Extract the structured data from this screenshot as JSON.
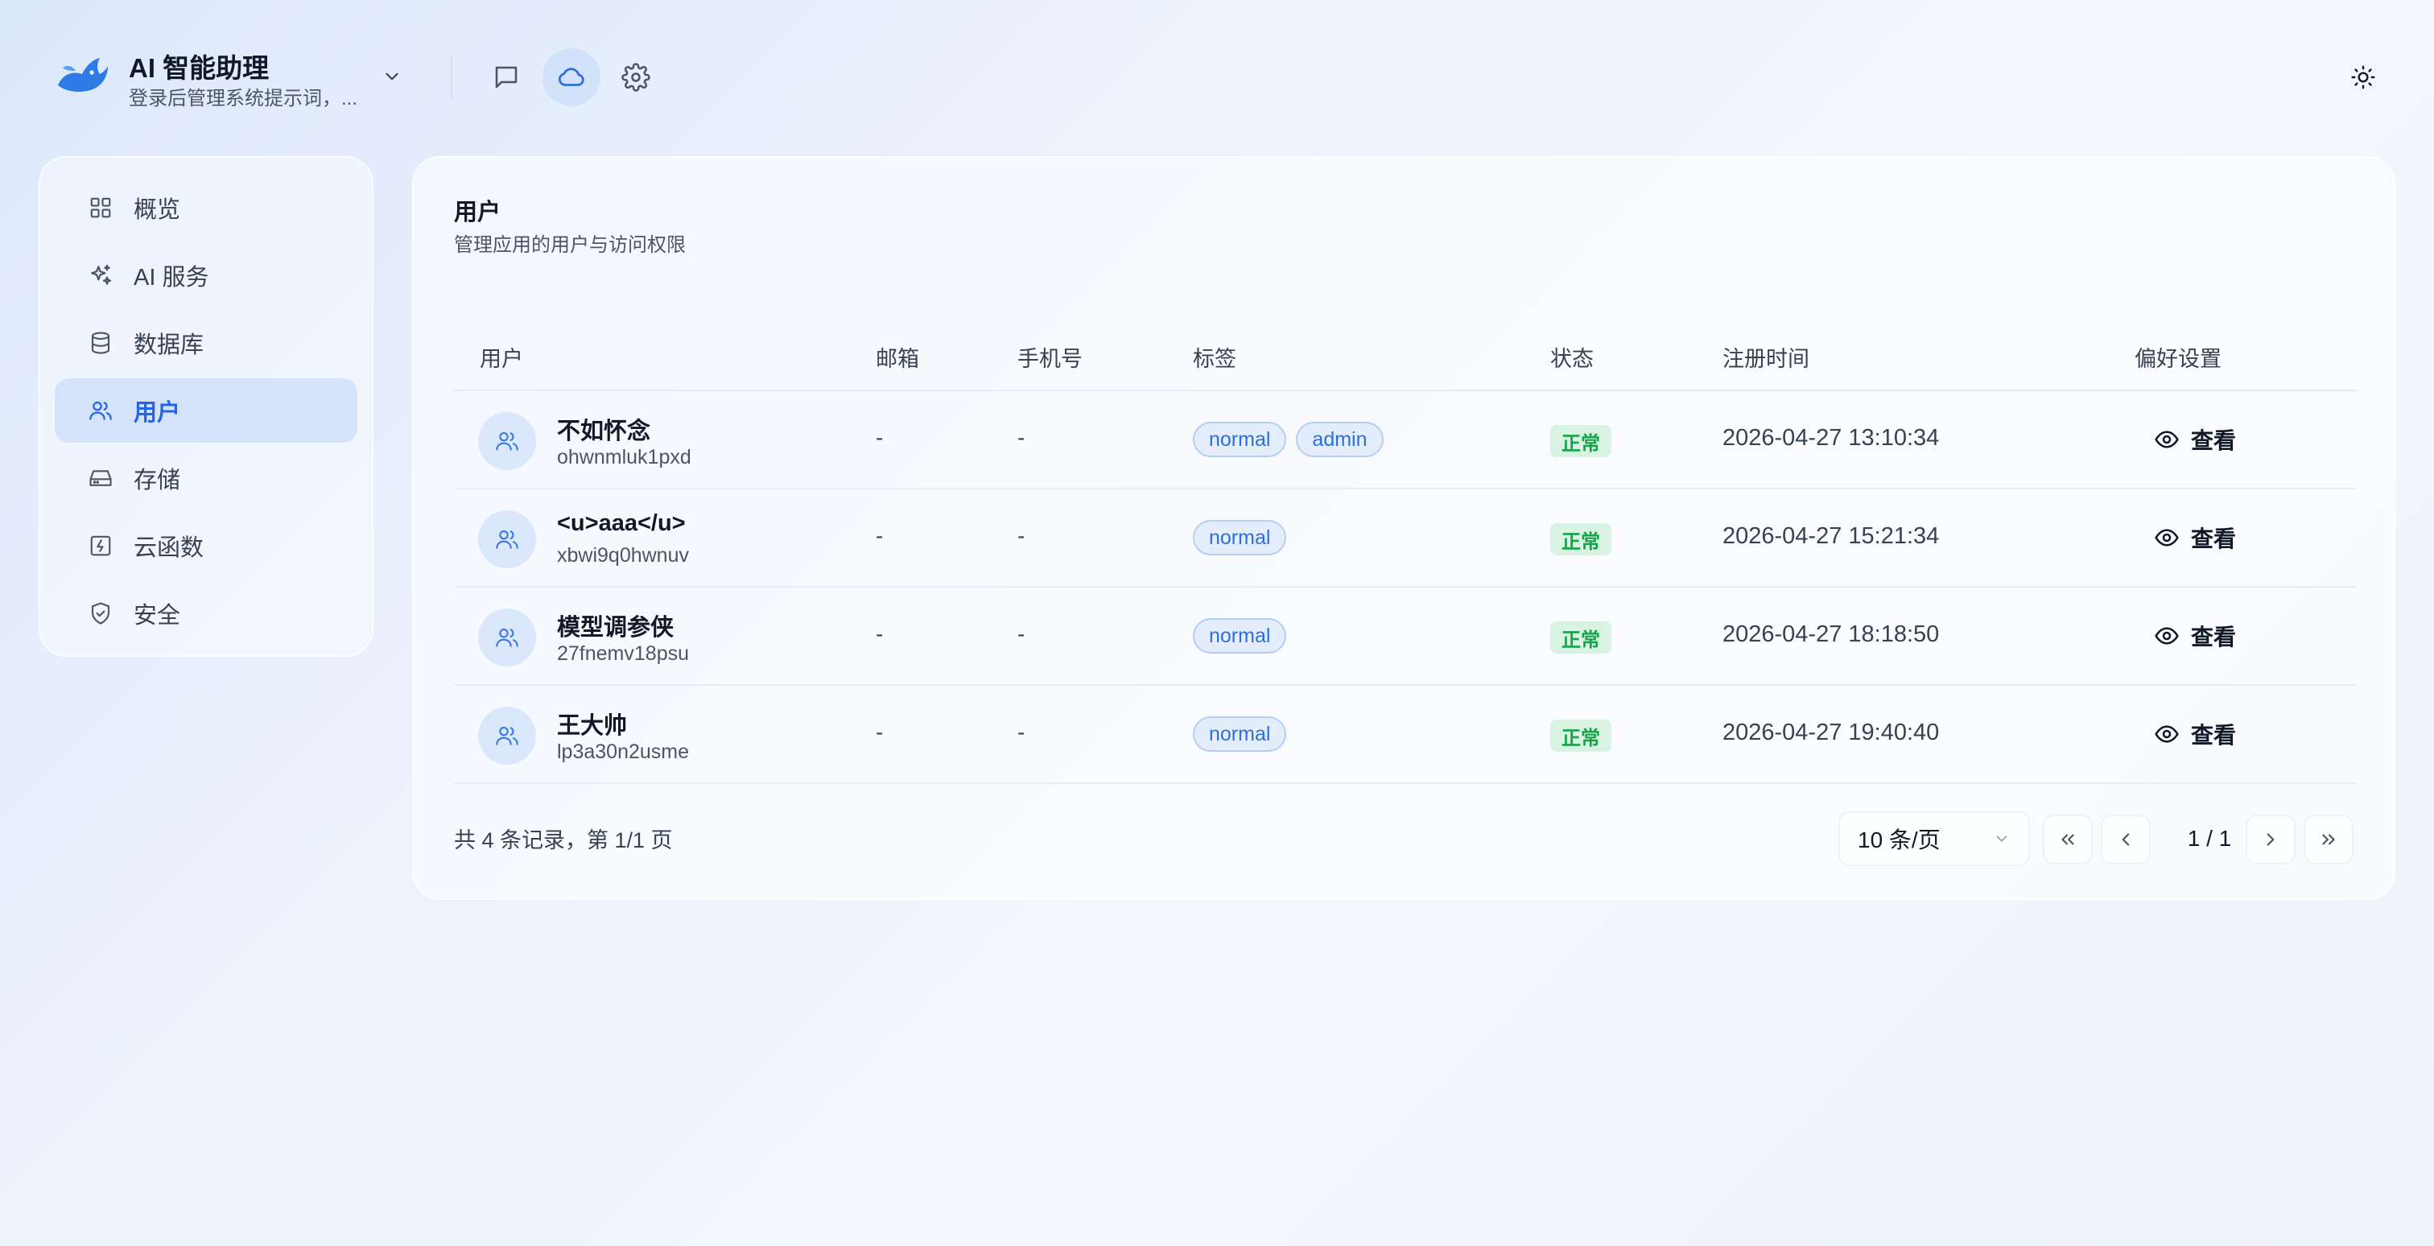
{
  "app": {
    "title": "AI 智能助理",
    "subtitle": "登录后管理系统提示词，..."
  },
  "header": {
    "icons": [
      "chat-icon",
      "cloud-icon",
      "settings-icon"
    ],
    "active_icon": "cloud-icon",
    "theme_icon": "sun-icon"
  },
  "sidebar": {
    "items": [
      {
        "label": "概览",
        "icon": "grid-icon"
      },
      {
        "label": "AI 服务",
        "icon": "sparkle-icon"
      },
      {
        "label": "数据库",
        "icon": "database-icon"
      },
      {
        "label": "用户",
        "icon": "users-icon",
        "active": true
      },
      {
        "label": "存储",
        "icon": "storage-icon"
      },
      {
        "label": "云函数",
        "icon": "function-icon"
      },
      {
        "label": "安全",
        "icon": "shield-icon"
      }
    ]
  },
  "page": {
    "title": "用户",
    "description": "管理应用的用户与访问权限"
  },
  "table": {
    "columns": [
      "用户",
      "邮箱",
      "手机号",
      "标签",
      "状态",
      "注册时间",
      "偏好设置"
    ],
    "rows": [
      {
        "name": "不如怀念",
        "id": "ohwnmluk1pxd",
        "email": "-",
        "phone": "-",
        "tags": [
          "normal",
          "admin"
        ],
        "status": "正常",
        "registered": "2026-04-27 13:10:34",
        "action": "查看"
      },
      {
        "name": "<u>aaa</u>",
        "id": "xbwi9q0hwnuv",
        "email": "-",
        "phone": "-",
        "tags": [
          "normal"
        ],
        "status": "正常",
        "registered": "2026-04-27 15:21:34",
        "action": "查看"
      },
      {
        "name": "模型调参侠",
        "id": "27fnemv18psu",
        "email": "-",
        "phone": "-",
        "tags": [
          "normal"
        ],
        "status": "正常",
        "registered": "2026-04-27 18:18:50",
        "action": "查看"
      },
      {
        "name": "王大帅",
        "id": "lp3a30n2usme",
        "email": "-",
        "phone": "-",
        "tags": [
          "normal"
        ],
        "status": "正常",
        "registered": "2026-04-27 19:40:40",
        "action": "查看"
      }
    ]
  },
  "pagination": {
    "summary": "共 4 条记录，第 1/1 页",
    "page_size": "10 条/页",
    "page_info": "1 / 1"
  },
  "colors": {
    "accent": "#2563eb",
    "active_nav_bg": "#d5e3fa",
    "status_green": "#16a34a",
    "tag_blue": "#2e6fd8"
  }
}
